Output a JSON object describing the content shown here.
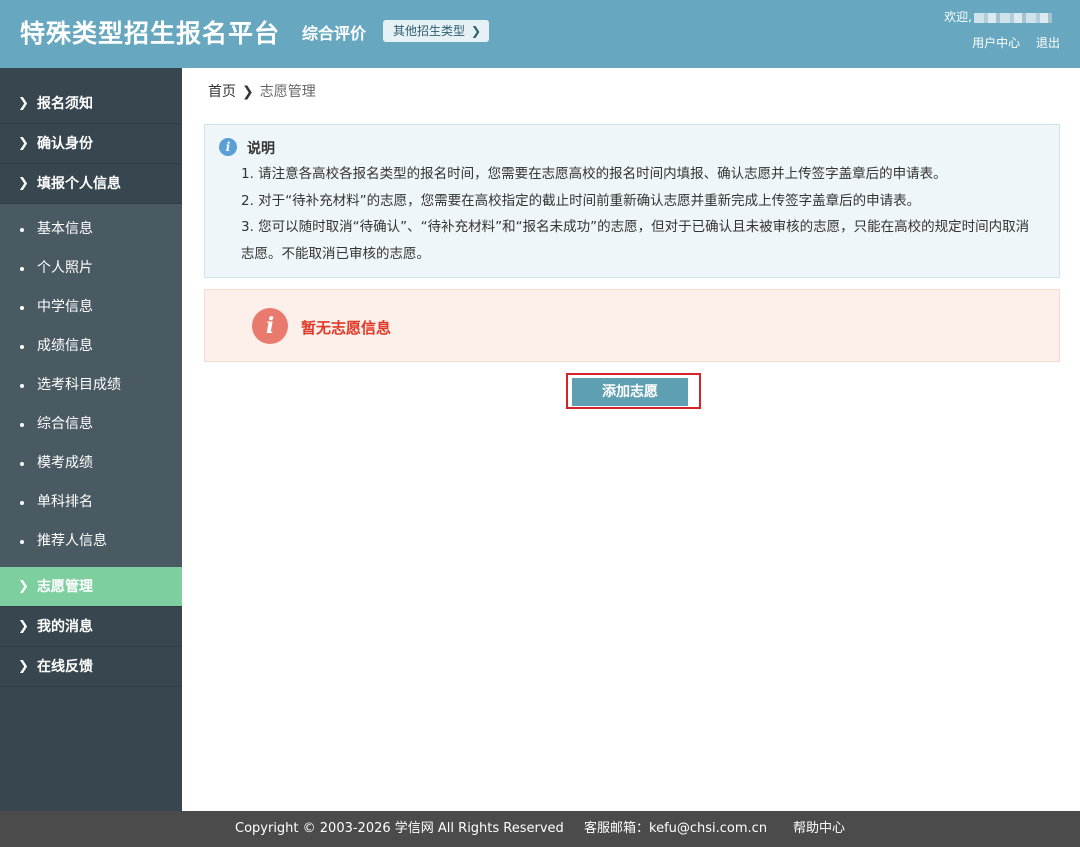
{
  "header": {
    "app_title": "特殊类型招生报名平台",
    "subtitle": "综合评价",
    "type_button": "其他招生类型",
    "welcome": "欢迎,",
    "user_center": "用户中心",
    "logout": "退出"
  },
  "sidebar": {
    "main_top": [
      {
        "label": "报名须知"
      },
      {
        "label": "确认身份"
      },
      {
        "label": "填报个人信息"
      }
    ],
    "sub_items": [
      {
        "label": "基本信息"
      },
      {
        "label": "个人照片"
      },
      {
        "label": "中学信息"
      },
      {
        "label": "成绩信息"
      },
      {
        "label": "选考科目成绩"
      },
      {
        "label": "综合信息"
      },
      {
        "label": "模考成绩"
      },
      {
        "label": "单科排名"
      },
      {
        "label": "推荐人信息"
      }
    ],
    "main_bottom": [
      {
        "label": "志愿管理",
        "active": true
      },
      {
        "label": "我的消息"
      },
      {
        "label": "在线反馈"
      }
    ]
  },
  "breadcrumb": {
    "home": "首页",
    "current": "志愿管理"
  },
  "info": {
    "title": "说明",
    "lines": [
      "1. 请注意各高校各报名类型的报名时间，您需要在志愿高校的报名时间内填报、确认志愿并上传签字盖章后的申请表。",
      "2. 对于“待补充材料”的志愿，您需要在高校指定的截止时间前重新确认志愿并重新完成上传签字盖章后的申请表。",
      "3. 您可以随时取消“待确认”、“待补充材料”和“报名未成功”的志愿，但对于已确认且未被审核的志愿，只能在高校的规定时间内取消志愿。不能取消已审核的志愿。"
    ]
  },
  "warning": {
    "text": "暂无志愿信息"
  },
  "add_button": "添加志愿",
  "footer": {
    "copyright": "Copyright © 2003-2026 学信网 All Rights Reserved",
    "email": "客服邮箱：kefu@chsi.com.cn",
    "help": "帮助中心"
  },
  "colors": {
    "header_bg": "#67a8c0",
    "sidebar_bg": "#38474f",
    "active_nav": "#7ecfa0",
    "warning_text": "#e03a2a",
    "button_bg": "#5f9fb2"
  }
}
